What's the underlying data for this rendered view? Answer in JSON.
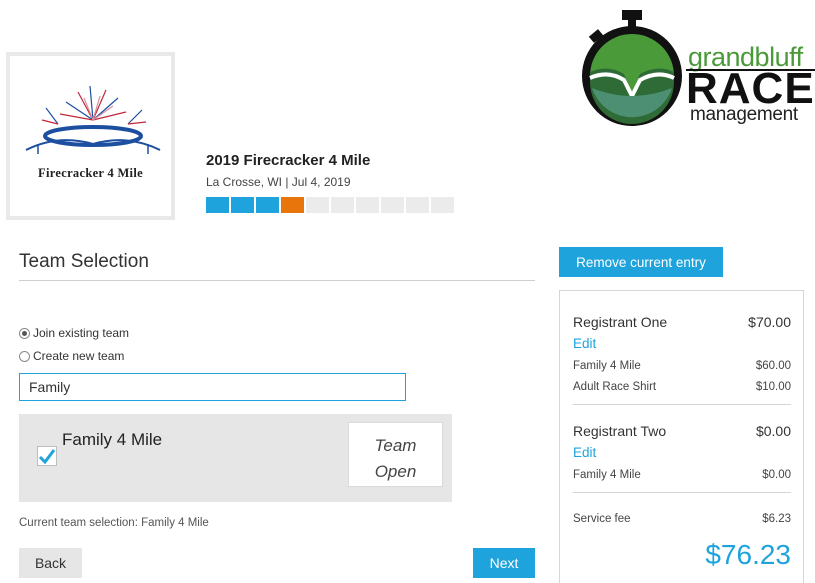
{
  "event": {
    "logo_text_line1": "Firecracker 4 Mile",
    "title": "2019 Firecracker 4 Mile",
    "subtitle": "La Crosse, WI | Jul 4, 2019",
    "progress": {
      "total_steps": 10,
      "completed": 3,
      "current": 4
    }
  },
  "brand": {
    "line1": "grandbluff",
    "line2": "RACE",
    "line3": "management",
    "colors": {
      "green": "#4a9a3a",
      "dark_green": "#2f6b36",
      "teal": "#4d8f73"
    }
  },
  "team_selection": {
    "title": "Team Selection",
    "options": [
      {
        "label": "Join existing team",
        "selected": true
      },
      {
        "label": "Create new team",
        "selected": false
      }
    ],
    "search_value": "Family",
    "results": [
      {
        "name": "Family 4 Mile",
        "checked": true,
        "status_line1": "Team",
        "status_line2": "Open"
      }
    ],
    "current_selection": "Current team selection: Family 4 Mile"
  },
  "nav": {
    "back_label": "Back",
    "next_label": "Next"
  },
  "summary": {
    "remove_label": "Remove current entry",
    "registrants": [
      {
        "name": "Registrant One",
        "amount": "$70.00",
        "edit_label": "Edit",
        "items": [
          {
            "label": "Family 4 Mile",
            "amount": "$60.00"
          },
          {
            "label": "Adult Race Shirt",
            "amount": "$10.00"
          }
        ]
      },
      {
        "name": "Registrant Two",
        "amount": "$0.00",
        "edit_label": "Edit",
        "items": [
          {
            "label": "Family 4 Mile",
            "amount": "$0.00"
          }
        ]
      }
    ],
    "service_fee_label": "Service fee",
    "service_fee_amount": "$6.23",
    "total": "$76.23"
  },
  "colors": {
    "accent": "#1fa3dc",
    "progress_current": "#e8740c"
  }
}
